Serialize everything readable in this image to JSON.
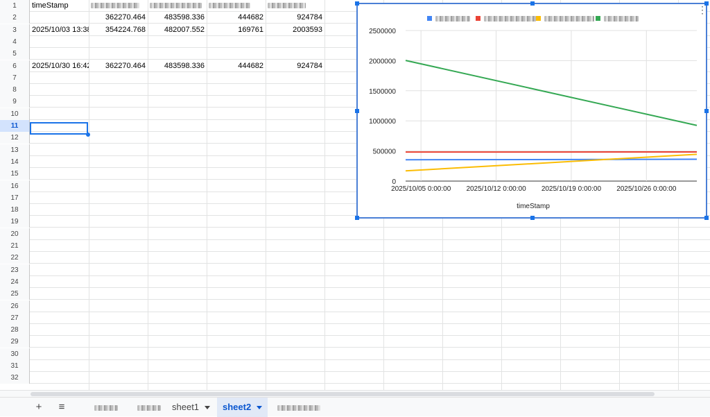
{
  "sheet": {
    "row_numbers": [
      "1",
      "2",
      "3",
      "4",
      "5",
      "6",
      "7",
      "8",
      "9",
      "10",
      "11",
      "12",
      "13",
      "14",
      "15",
      "16",
      "17",
      "18",
      "19",
      "20",
      "21",
      "22",
      "23",
      "24",
      "25",
      "26",
      "27",
      "28",
      "29",
      "30",
      "31",
      "32"
    ],
    "selected_row": "11",
    "cells": {
      "A1": "timeStamp",
      "B2": "362270.464",
      "C2": "483598.336",
      "D2": "444682",
      "E2": "924784",
      "A3": "2025/10/03 13:38",
      "B3": "354224.768",
      "C3": "482007.552",
      "D3": "169761",
      "E3": "2003593",
      "A6": "2025/10/30 16:42",
      "B6": "362270.464",
      "C6": "483598.336",
      "D6": "444682",
      "E6": "924784"
    }
  },
  "tabs": {
    "add_label": "+",
    "menu_label": "≡",
    "items": [
      {
        "label": "",
        "blurred": true
      },
      {
        "label": "",
        "blurred": true
      },
      {
        "label": "sheet1",
        "blurred": false
      },
      {
        "label": "sheet2",
        "blurred": false,
        "active": true
      },
      {
        "label": "",
        "blurred": true
      }
    ]
  },
  "chart_data": {
    "type": "line",
    "title": "",
    "xlabel": "timeStamp",
    "ylabel": "",
    "x_ticks": [
      "2025/10/05 0:00:00",
      "2025/10/12 0:00:00",
      "2025/10/19 0:00:00",
      "2025/10/26 0:00:00"
    ],
    "y_ticks": [
      "0",
      "500000",
      "1000000",
      "1500000",
      "2000000",
      "2500000"
    ],
    "ylim": [
      0,
      2500000
    ],
    "x_range": [
      "2025/10/03 13:38",
      "2025/10/30 16:42"
    ],
    "grid": true,
    "legend_position": "top",
    "series": [
      {
        "color": "#4285f4",
        "x": [
          "2025/10/03 13:38",
          "2025/10/30 16:42"
        ],
        "y": [
          354224.768,
          362270.464
        ]
      },
      {
        "color": "#ea4335",
        "x": [
          "2025/10/03 13:38",
          "2025/10/30 16:42"
        ],
        "y": [
          482007.552,
          483598.336
        ]
      },
      {
        "color": "#fbbc04",
        "x": [
          "2025/10/03 13:38",
          "2025/10/30 16:42"
        ],
        "y": [
          169761,
          444682
        ]
      },
      {
        "color": "#34a853",
        "x": [
          "2025/10/03 13:38",
          "2025/10/30 16:42"
        ],
        "y": [
          2003593,
          924784
        ]
      }
    ]
  }
}
